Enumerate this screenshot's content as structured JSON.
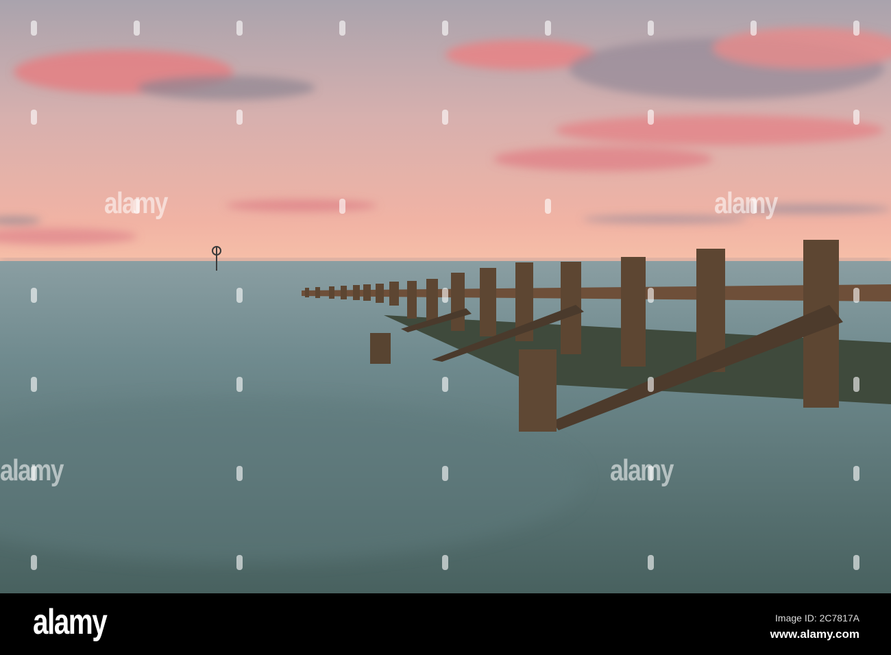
{
  "watermark": {
    "text": "alamy"
  },
  "footer": {
    "logo": "alamy",
    "image_id": "Image ID: 2C7817A",
    "url": "www.alamy.com"
  },
  "colors": {
    "sky_top": "#a9a3ad",
    "sky_horizon": "#f4b2a2",
    "cloud": "#e98a86",
    "water_top": "#7e9598",
    "water_bottom": "#4c6669",
    "wood": "#5a4430",
    "footer_bg": "#000000"
  }
}
